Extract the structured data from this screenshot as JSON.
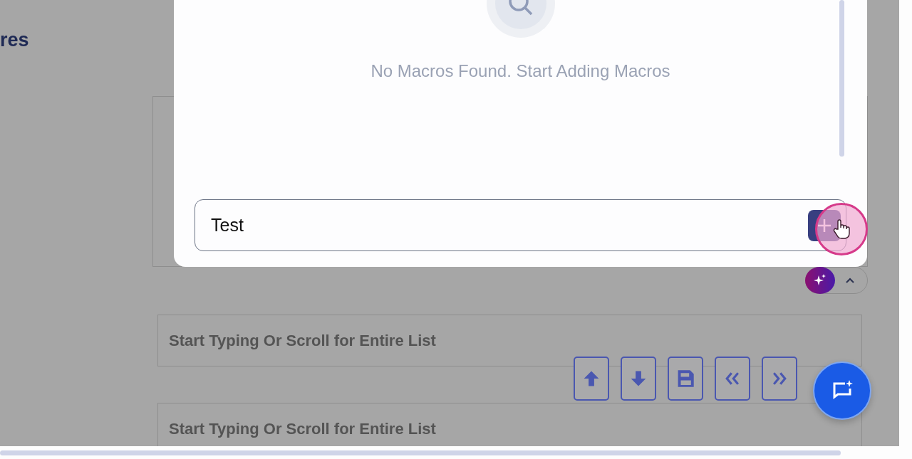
{
  "background_page": {
    "heading": "res",
    "assistant_toggle": {
      "expanded": true
    },
    "list_fields": [
      {
        "placeholder": "Start Typing Or Scroll for Entire List"
      },
      {
        "placeholder": "Start Typing Or Scroll for Entire List"
      }
    ],
    "toolbar": [
      {
        "kind": "up"
      },
      {
        "kind": "down"
      },
      {
        "kind": "save"
      },
      {
        "kind": "first"
      },
      {
        "kind": "last"
      }
    ]
  },
  "modal": {
    "empty_message": "No Macros Found. Start Adding Macros",
    "macro_input": {
      "value": "Test"
    }
  }
}
